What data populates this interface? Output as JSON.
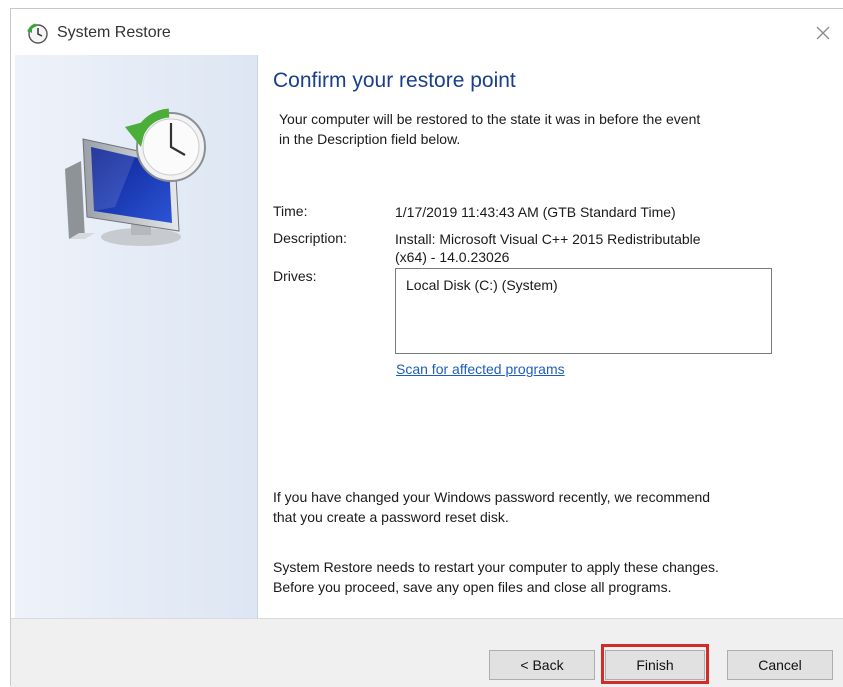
{
  "window": {
    "title": "System Restore"
  },
  "content": {
    "heading": "Confirm your restore point",
    "intro_line1": "Your computer will be restored to the state it was in before the event",
    "intro_line2": "in the Description field below.",
    "time_label": "Time:",
    "time_value": "1/17/2019 11:43:43 AM (GTB Standard Time)",
    "description_label": "Description:",
    "description_line1": "Install: Microsoft Visual C++ 2015 Redistributable",
    "description_line2": "(x64) - 14.0.23026",
    "drives_label": "Drives:",
    "drives": [
      "Local Disk (C:) (System)"
    ],
    "scan_link": "Scan for affected programs",
    "password_line1": "If you have changed your Windows password recently, we recommend",
    "password_line2": "that you create a password reset disk.",
    "restart_line1": "System Restore needs to restart your computer to apply these changes.",
    "restart_line2": "Before you proceed, save any open files and close all programs."
  },
  "footer": {
    "back_label": "< Back",
    "finish_label": "Finish",
    "cancel_label": "Cancel"
  },
  "icons": {
    "title": "system-restore-icon",
    "close": "close-icon",
    "hero": "restore-monitor-clock-icon"
  },
  "colors": {
    "heading": "#1a3e8c",
    "link": "#1c5ebd",
    "highlight": "#d42a2a",
    "sidepanel": "#dde6f3"
  }
}
